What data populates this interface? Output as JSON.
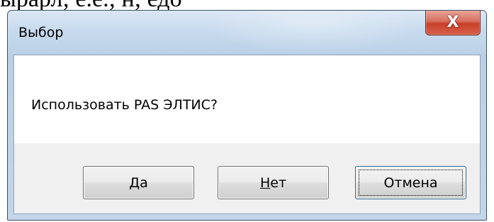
{
  "background_text": "ырарл; е.е.; н; едо",
  "window": {
    "title": "Выбор",
    "close_glyph": "X"
  },
  "message": "Использовать PAS ЭЛТИС?",
  "buttons": {
    "yes": {
      "mnemonic": "Д",
      "rest": "а"
    },
    "no": {
      "mnemonic": "Н",
      "rest": "ет"
    },
    "cancel": {
      "label": "Отмена"
    }
  }
}
